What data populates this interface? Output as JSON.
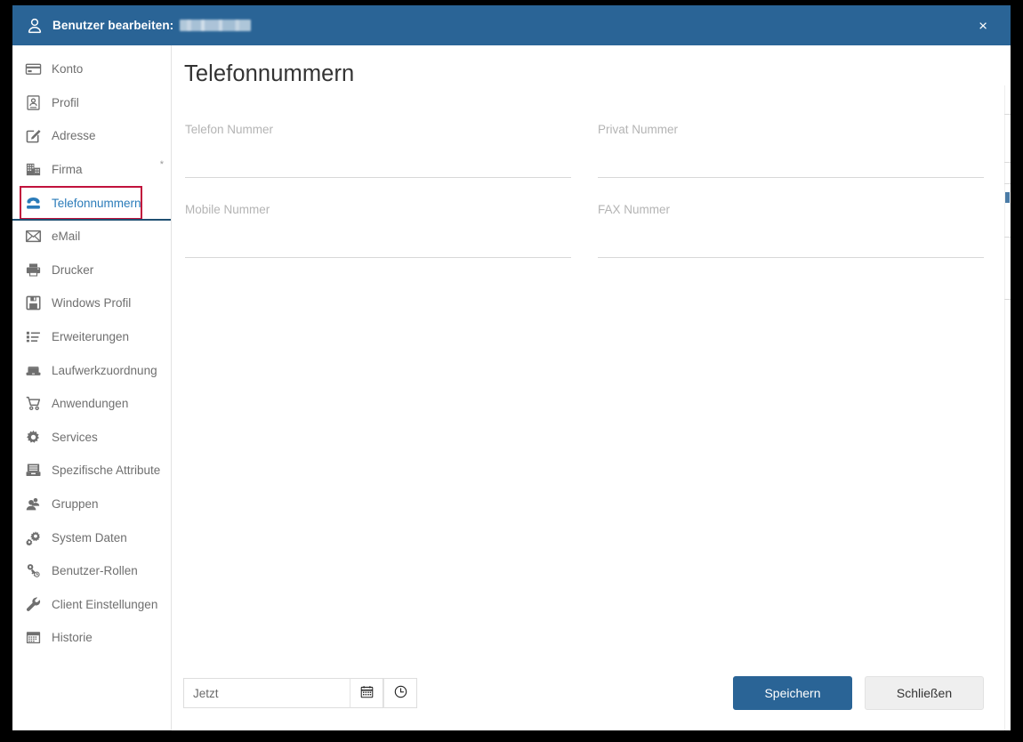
{
  "window": {
    "title_prefix": "Benutzer bearbeiten:",
    "title_value_redacted": "",
    "user_icon": "user-icon",
    "close_label": "×",
    "header_color": "#2a6496"
  },
  "sidebar": {
    "items": [
      {
        "label": "Konto",
        "icon": "credit-card-icon",
        "active": false,
        "required_marker": ""
      },
      {
        "label": "Profil",
        "icon": "id-card-icon",
        "active": false,
        "required_marker": ""
      },
      {
        "label": "Adresse",
        "icon": "edit-square-icon",
        "active": false,
        "required_marker": ""
      },
      {
        "label": "Firma",
        "icon": "building-icon",
        "active": false,
        "required_marker": "*"
      },
      {
        "label": "Telefonnummern",
        "icon": "phone-icon",
        "active": true,
        "required_marker": ""
      },
      {
        "label": "eMail",
        "icon": "envelope-icon",
        "active": false,
        "required_marker": ""
      },
      {
        "label": "Drucker",
        "icon": "printer-icon",
        "active": false,
        "required_marker": ""
      },
      {
        "label": "Windows Profil",
        "icon": "floppy-disk-icon",
        "active": false,
        "required_marker": ""
      },
      {
        "label": "Erweiterungen",
        "icon": "list-icon",
        "active": false,
        "required_marker": ""
      },
      {
        "label": "Laufwerkzuordnung",
        "icon": "drive-icon",
        "active": false,
        "required_marker": ""
      },
      {
        "label": "Anwendungen",
        "icon": "shopping-cart-icon",
        "active": false,
        "required_marker": ""
      },
      {
        "label": "Services",
        "icon": "gear-icon",
        "active": false,
        "required_marker": ""
      },
      {
        "label": "Spezifische Attribute",
        "icon": "archive-icon",
        "active": false,
        "required_marker": ""
      },
      {
        "label": "Gruppen",
        "icon": "users-icon",
        "active": false,
        "required_marker": ""
      },
      {
        "label": "System Daten",
        "icon": "cogs-icon",
        "active": false,
        "required_marker": ""
      },
      {
        "label": "Benutzer-Rollen",
        "icon": "key-icon",
        "active": false,
        "required_marker": ""
      },
      {
        "label": "Client Einstellungen",
        "icon": "wrench-icon",
        "active": false,
        "required_marker": ""
      },
      {
        "label": "Historie",
        "icon": "calendar-icon",
        "active": false,
        "required_marker": ""
      }
    ],
    "selection_outline_color": "#c1123c",
    "selection_underline_color": "#1f4f72",
    "active_text_color": "#2a7bb9"
  },
  "main": {
    "page_title": "Telefonnummern",
    "fields": [
      {
        "label": "Telefon Nummer",
        "value": "",
        "placeholder": ""
      },
      {
        "label": "Privat Nummer",
        "value": "",
        "placeholder": ""
      },
      {
        "label": "Mobile Nummer",
        "value": "",
        "placeholder": ""
      },
      {
        "label": "FAX Nummer",
        "value": "",
        "placeholder": ""
      }
    ]
  },
  "footer": {
    "datetime": {
      "value": "",
      "placeholder": "Jetzt",
      "calendar_icon": "calendar-icon",
      "clock_icon": "clock-icon"
    },
    "save_label": "Speichern",
    "close_label": "Schließen",
    "save_color": "#2a6496",
    "close_color": "#efefef"
  }
}
